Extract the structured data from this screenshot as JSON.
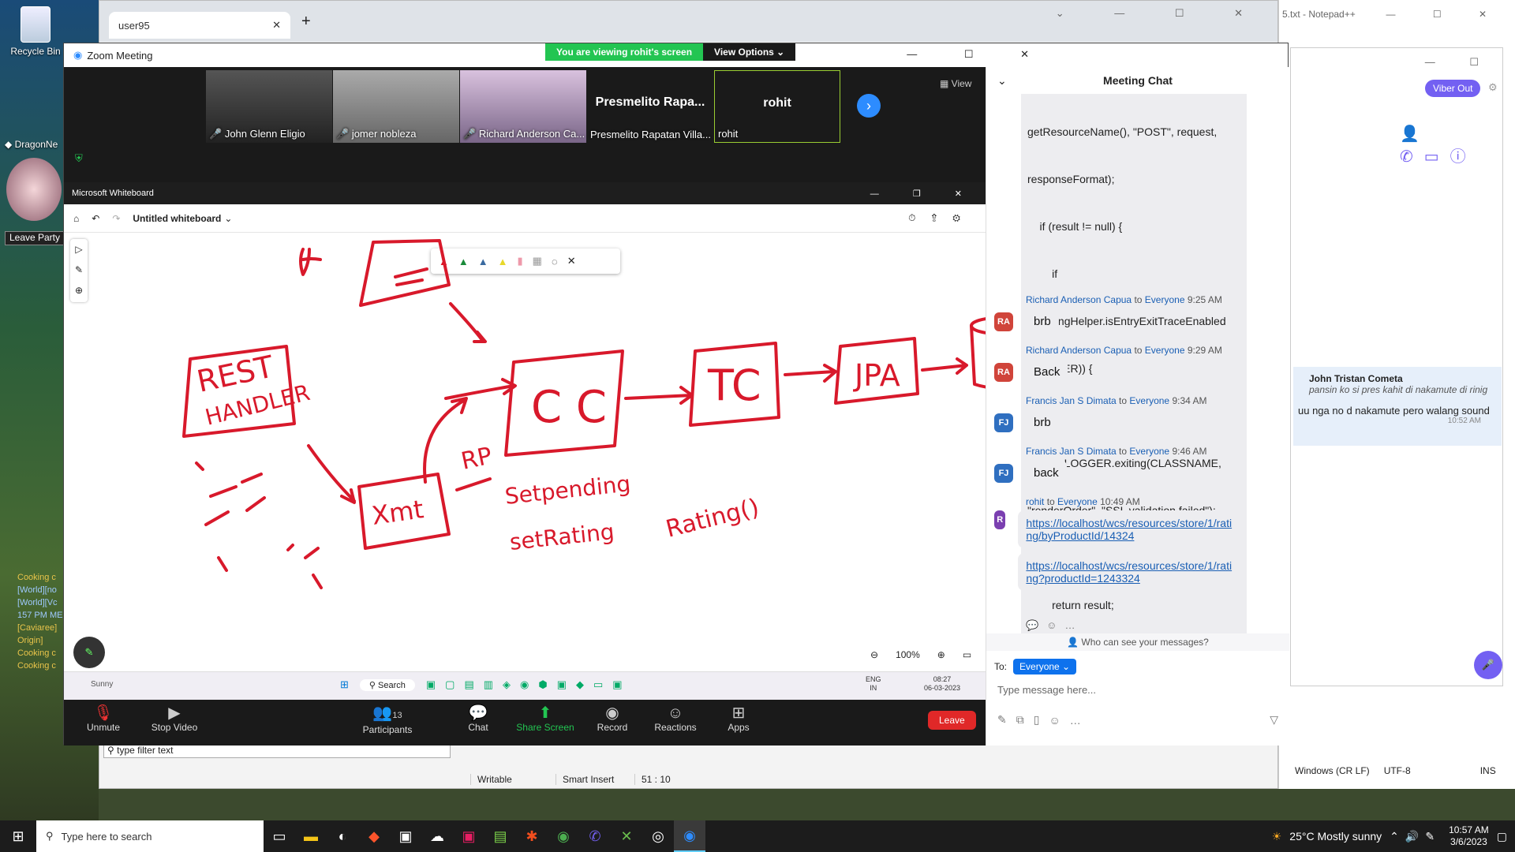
{
  "desktop": {
    "icons": [
      "Recycle Bin",
      "DragonNe",
      "Leave Party"
    ],
    "game_chat": [
      "Cooking c",
      "[World][no",
      "[World][Vc",
      "157 PM ME",
      "[Caviaree]",
      "Origin]",
      "Cooking c",
      "Cooking c"
    ]
  },
  "browser": {
    "tab_title": "user95",
    "new_tab": "+"
  },
  "notepad": {
    "title": "5.txt - Notepad++",
    "status": {
      "eol": "Windows (CR LF)",
      "encoding": "UTF-8",
      "mode": "INS"
    }
  },
  "eclipse_status": {
    "writable": "Writable",
    "insert": "Smart Insert",
    "position": "51 : 10",
    "filter_placeholder": "type filter text"
  },
  "viber": {
    "viber_out": "Viber Out",
    "message_sender": "John Tristan Cometa",
    "quoted": "pansin ko si pres kahit di nakamute di rinig",
    "reply": "uu nga no d nakamute pero walang sound",
    "time": "10:52 AM"
  },
  "zoom": {
    "title": "Zoom Meeting",
    "viewing_banner": "You are viewing rohit's screen",
    "view_options": "View Options",
    "view_label": "View",
    "participants": [
      {
        "name": "John Glenn Eligio",
        "muted": true
      },
      {
        "name": "jomer nobleza",
        "muted": true
      },
      {
        "name": "Richard Anderson Ca...",
        "muted": true
      },
      {
        "name": "Presmelito Rapatan Villa...",
        "big": "Presmelito Rapa...",
        "muted": false
      },
      {
        "name": "rohit",
        "big": "rohit",
        "muted": false
      }
    ],
    "controls": {
      "unmute": "Unmute",
      "stop_video": "Stop Video",
      "participants": "Participants",
      "participant_count": "13",
      "chat": "Chat",
      "share": "Share Screen",
      "record": "Record",
      "reactions": "Reactions",
      "apps": "Apps",
      "leave": "Leave"
    }
  },
  "whiteboard": {
    "app_title": "Microsoft Whiteboard",
    "doc_title": "Untitled whiteboard",
    "zoom": "100%",
    "inner_taskbar": {
      "search": "Search",
      "lang": "ENG",
      "region": "IN",
      "time": "08:27",
      "date": "06-03-2023",
      "weather": "Sunny"
    }
  },
  "chat": {
    "title": "Meeting Chat",
    "code_lines": [
      "getResourceName(), \"POST\", request,",
      "responseFormat);",
      "    if (result != null) {",
      "        if",
      "(LoggingHelper.isEntryExitTraceEnabled",
      "(LOGGER)) {",
      "",
      "            LOGGER.exiting(CLASSNAME,",
      "\"renderOrder\", \"SSL validation failed\");",
      "        }",
      "        return result;",
      "    }"
    ],
    "messages": [
      {
        "initials": "RA",
        "color": "#d0443a",
        "from": "Richard Anderson Capua",
        "to": "Everyone",
        "time": "9:25 AM",
        "text": "brb"
      },
      {
        "initials": "RA",
        "color": "#d0443a",
        "from": "Richard Anderson Capua",
        "to": "Everyone",
        "time": "9:29 AM",
        "text": "Back"
      },
      {
        "initials": "FJ",
        "color": "#2f6fc0",
        "from": "Francis Jan S Dimata",
        "to": "Everyone",
        "time": "9:34 AM",
        "text": "brb"
      },
      {
        "initials": "FJ",
        "color": "#2f6fc0",
        "from": "Francis Jan S Dimata",
        "to": "Everyone",
        "time": "9:46 AM",
        "text": "back"
      }
    ],
    "rohit": {
      "initials": "R",
      "from": "rohit",
      "to": "Everyone",
      "time": "10:49 AM",
      "link1": "https://localhost/wcs/resources/store/1/rating/byProductId/14324",
      "link2": "https://localhost/wcs/resources/store/1/rating?productId=1243324"
    },
    "to_word": "to",
    "who_can_see": "Who can see your messages?",
    "to_label": "To:",
    "recipient": "Everyone",
    "placeholder": "Type message here..."
  },
  "taskbar": {
    "search_placeholder": "Type here to search",
    "weather": "25°C  Mostly sunny",
    "time": "10:57 AM",
    "date": "3/6/2023"
  }
}
